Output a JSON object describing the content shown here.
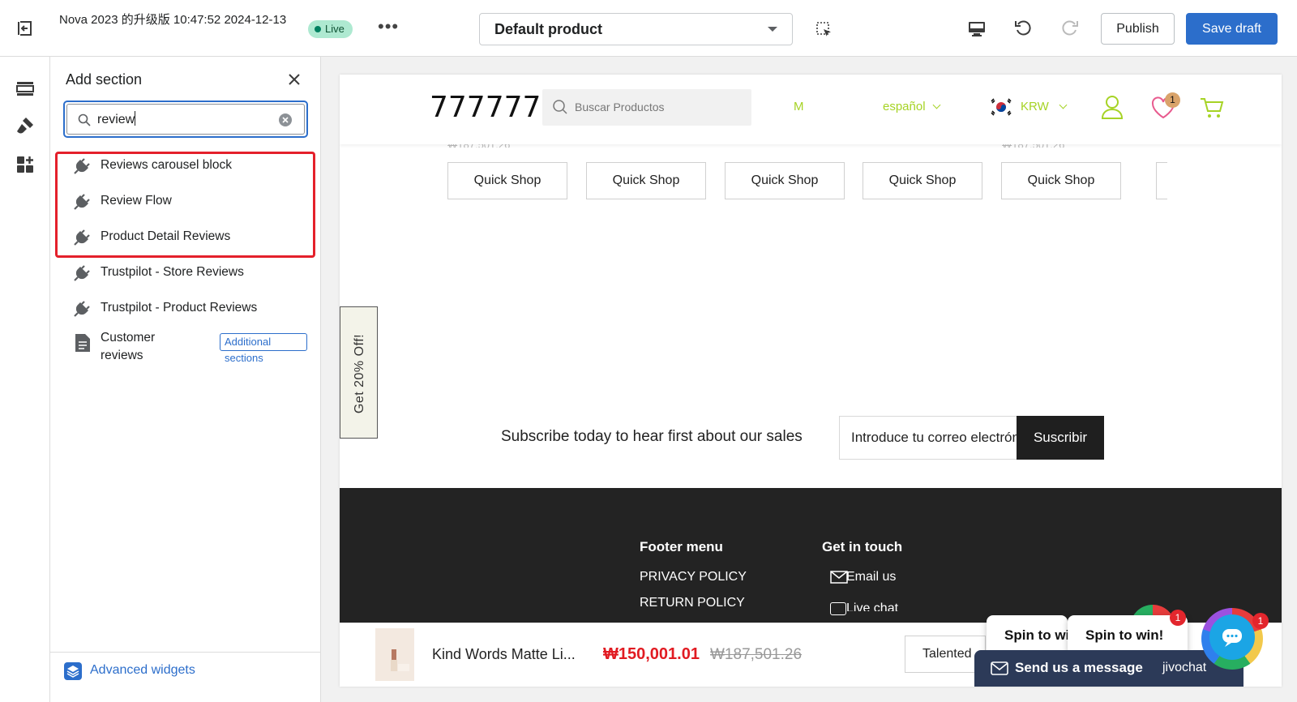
{
  "topbar": {
    "title": "Nova 2023 的升级版 10:47:52 2024-12-13",
    "live_label": "Live",
    "more_label": "•••",
    "product_select_value": "Default product",
    "publish_label": "Publish",
    "save_draft_label": "Save draft"
  },
  "panel": {
    "title": "Add section",
    "search_value": "review",
    "results": [
      {
        "label": "Reviews carousel block",
        "icon": "plug-icon"
      },
      {
        "label": "Review Flow",
        "icon": "plug-icon"
      },
      {
        "label": "Product Detail Reviews",
        "icon": "plug-icon"
      },
      {
        "label": "Trustpilot - Store Reviews",
        "icon": "plug-icon"
      },
      {
        "label": "Trustpilot - Product Reviews",
        "icon": "plug-icon"
      }
    ],
    "customer_reviews": {
      "label": "Customer reviews",
      "badge": "Additional sections",
      "icon": "document-icon"
    },
    "footer_label": "Advanced widgets"
  },
  "store": {
    "logo": "777777",
    "search_placeholder": "Buscar Productos",
    "nav_item": "M",
    "language": "español",
    "currency": "KRW",
    "wishlist_count": "1",
    "cut_price": "₩187,501.26",
    "quick_shop_label": "Quick Shop",
    "promo_tab": "Get 20% Off!",
    "subscribe_text": "Subscribe today to hear first about our sales",
    "subscribe_placeholder": "Introduce tu correo electrónico",
    "subscribe_button": "Suscribir",
    "footer": {
      "menu_heading": "Footer menu",
      "menu_links": [
        "PRIVACY POLICY",
        "RETURN POLICY"
      ],
      "contact_heading": "Get in touch",
      "contact_links": [
        "Email us",
        "Live chat"
      ]
    },
    "sticky": {
      "product_name": "Kind Words Matte Li...",
      "price": "₩150,001.01",
      "old_price": "₩187,501.26",
      "variant": "Talented"
    }
  },
  "widgets": {
    "spin_label": "Spin to win!",
    "spin_badge": "1",
    "chat_badge": "1",
    "send_message": "Send us a message",
    "chat_brand": "jivochat"
  },
  "colors": {
    "primary": "#2c6ecb",
    "highlight": "#e4202b",
    "store_accent": "#a6d325",
    "price_red": "#e11b22"
  }
}
